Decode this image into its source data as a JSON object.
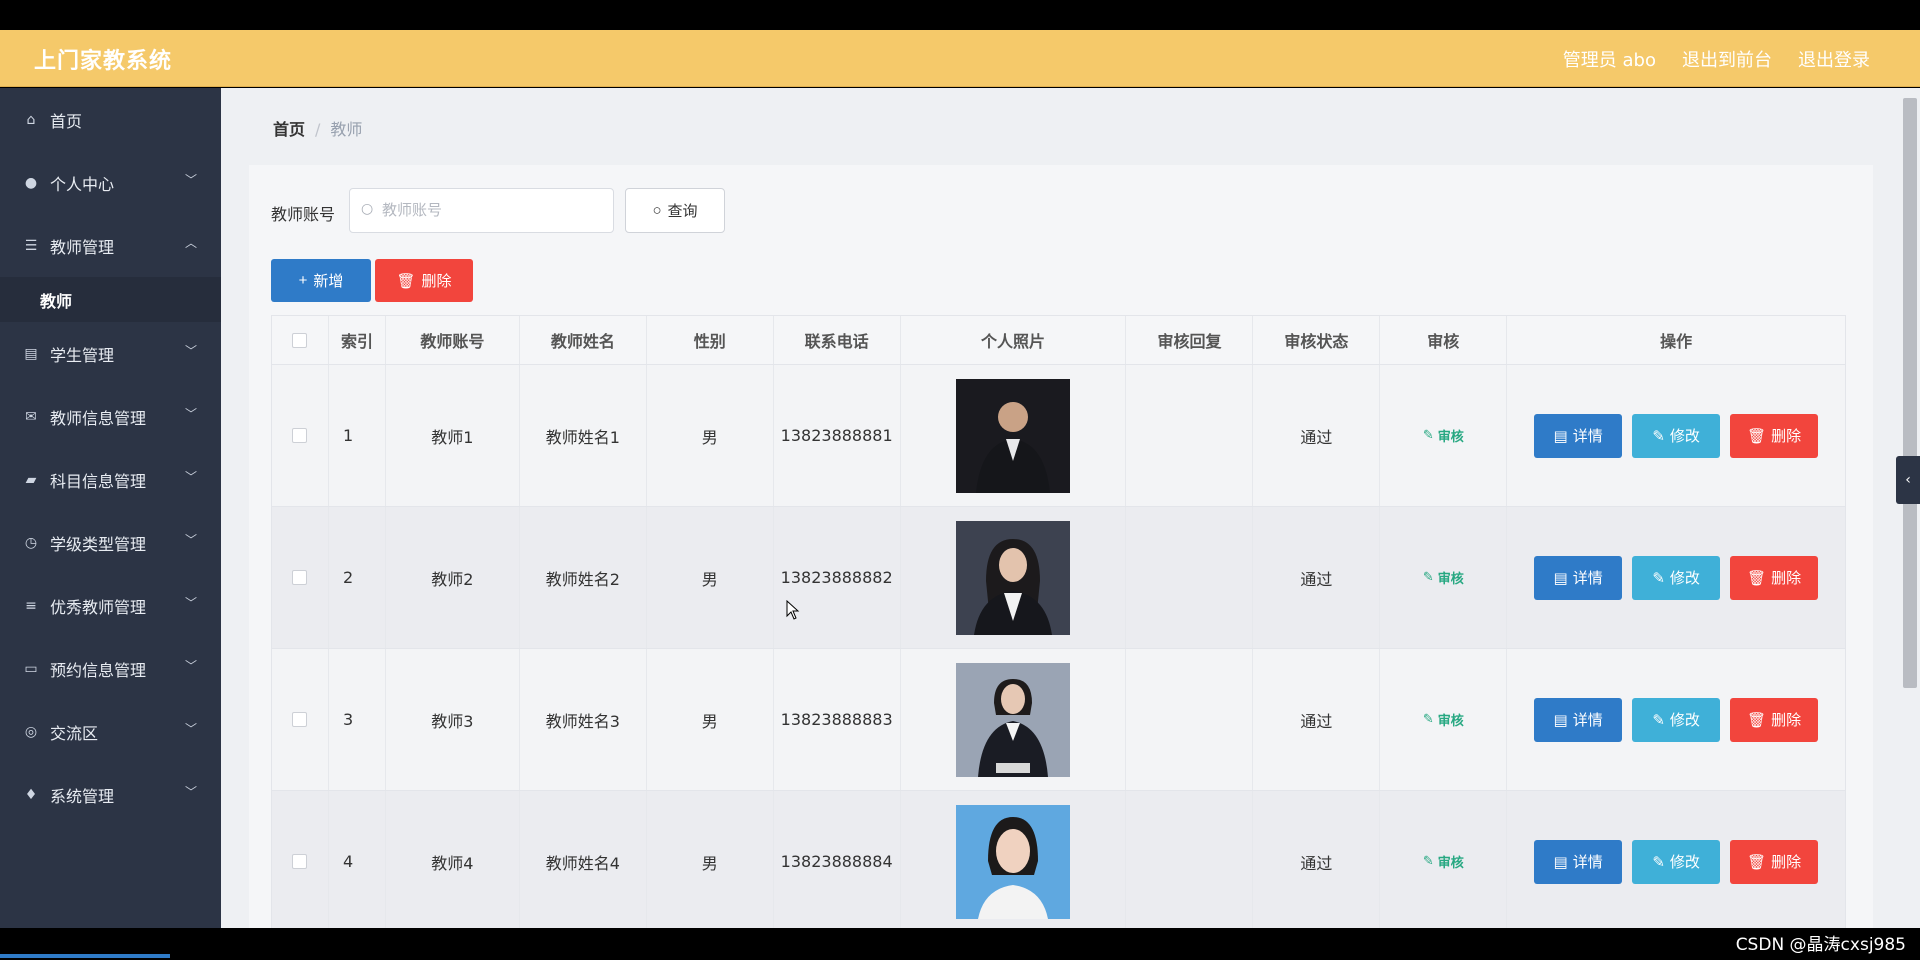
{
  "header": {
    "title": "上门家教系统",
    "admin": "管理员 abo",
    "to_front": "退出到前台",
    "logout": "退出登录"
  },
  "sidebar": {
    "items": [
      {
        "label": "首页",
        "icon": "home-icon"
      },
      {
        "label": "个人中心",
        "icon": "user-icon"
      },
      {
        "label": "教师管理",
        "icon": "list-icon"
      },
      {
        "label": "学生管理",
        "icon": "chart-icon"
      },
      {
        "label": "教师信息管理",
        "icon": "mail-icon"
      },
      {
        "label": "科目信息管理",
        "icon": "chat-icon"
      },
      {
        "label": "学级类型管理",
        "icon": "clock-icon"
      },
      {
        "label": "优秀教师管理",
        "icon": "sliders-icon"
      },
      {
        "label": "预约信息管理",
        "icon": "message-icon"
      },
      {
        "label": "交流区",
        "icon": "compass-icon"
      },
      {
        "label": "系统管理",
        "icon": "pin-icon"
      }
    ],
    "submenu_active": "教师"
  },
  "breadcrumb": {
    "home": "首页",
    "current": "教师"
  },
  "search": {
    "label": "教师账号",
    "placeholder": "教师账号",
    "query_label": "查询"
  },
  "toolbar": {
    "add_label": "新增",
    "delete_label": "删除"
  },
  "table": {
    "headers": [
      "索引",
      "教师账号",
      "教师姓名",
      "性别",
      "联系电话",
      "个人照片",
      "审核回复",
      "审核状态",
      "审核",
      "操作"
    ],
    "rows": [
      {
        "index": "1",
        "account": "教师1",
        "name": "教师姓名1",
        "gender": "男",
        "phone": "13823888881",
        "reply": "",
        "status": "通过"
      },
      {
        "index": "2",
        "account": "教师2",
        "name": "教师姓名2",
        "gender": "男",
        "phone": "13823888882",
        "reply": "",
        "status": "通过"
      },
      {
        "index": "3",
        "account": "教师3",
        "name": "教师姓名3",
        "gender": "男",
        "phone": "13823888883",
        "reply": "",
        "status": "通过"
      },
      {
        "index": "4",
        "account": "教师4",
        "name": "教师姓名4",
        "gender": "男",
        "phone": "13823888884",
        "reply": "",
        "status": "通过"
      }
    ],
    "audit_label": "审核",
    "op_detail": "详情",
    "op_edit": "修改",
    "op_delete": "删除"
  },
  "watermark": "CSDN @晶涛cxsj985",
  "colors": {
    "header": "#f5c96a",
    "sidebar": "#2c3445",
    "primary": "#2f7bc8",
    "danger": "#f2453d",
    "info": "#3fb0d8",
    "success": "#27a882"
  }
}
